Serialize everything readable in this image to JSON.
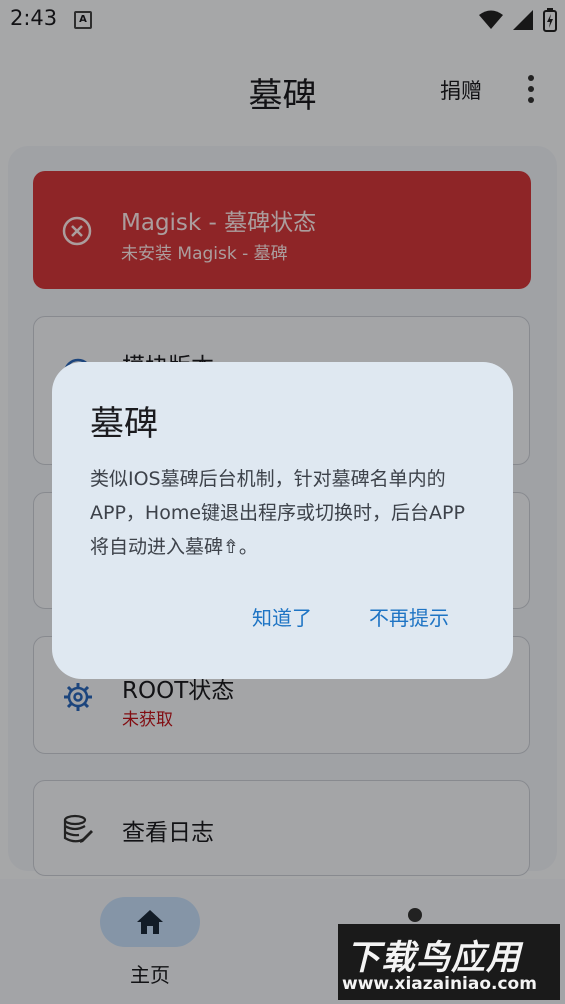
{
  "status_bar": {
    "time": "2:43",
    "notification_letter": "A"
  },
  "app_bar": {
    "title": "墓碑",
    "donate_label": "捐赠",
    "more_icon": "more-vert-icon"
  },
  "cards": {
    "status": {
      "title": "Magisk - 墓碑状态",
      "subtitle": "未安装  Magisk - 墓碑"
    },
    "module_version": {
      "title": "模块版本"
    },
    "root": {
      "title": "ROOT状态",
      "subtitle": "未获取"
    },
    "logs": {
      "title": "查看日志"
    }
  },
  "bottom_nav": {
    "home_label": "主页"
  },
  "dialog": {
    "title": "墓碑",
    "body": "类似IOS墓碑后台机制，针对墓碑名单内的APP，Home键退出程序或切换时，后台APP将自动进入墓碑⇮。",
    "ok_label": "知道了",
    "no_remind_label": "不再提示"
  },
  "watermark": {
    "line1": "下载鸟应用",
    "line2": "www.xiazainiao.com"
  },
  "colors": {
    "accent": "#1e74c4",
    "error_card": "#d2373a",
    "error_text": "#c0141b",
    "dialog_bg": "#dfe8f1"
  }
}
